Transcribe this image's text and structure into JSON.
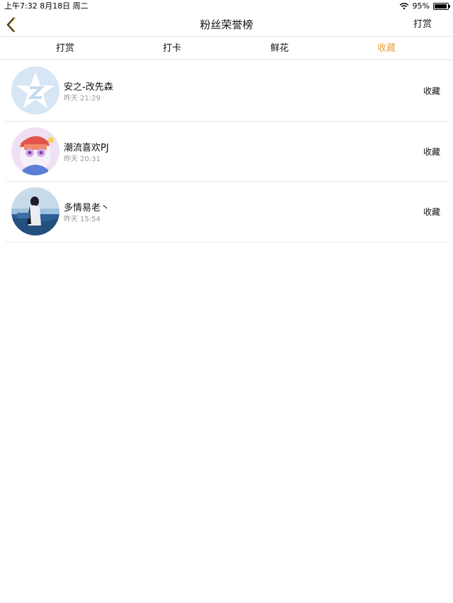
{
  "status_bar": {
    "time_date": "上午7:32   8月18日 周二",
    "battery": "95%",
    "battery_level": 0.95
  },
  "nav": {
    "back_icon": "chevron-left-icon",
    "title": "粉丝荣誉榜",
    "action": "打赏"
  },
  "tabs": [
    {
      "label": "打赏",
      "active": false
    },
    {
      "label": "打卡",
      "active": false
    },
    {
      "label": "鲜花",
      "active": false
    },
    {
      "label": "收藏",
      "active": true
    }
  ],
  "colors": {
    "accent": "#e8a33c",
    "divider": "#e6e6e6",
    "secondary_text": "#999999"
  },
  "list": [
    {
      "name": "安之-改先森",
      "time": "昨天 21:29",
      "action": "收藏",
      "avatar": "qq-logo-avatar"
    },
    {
      "name": "潮流喜欢PJ",
      "time": "昨天 20:31",
      "action": "收藏",
      "avatar": "cartoon-avatar"
    },
    {
      "name": "多情易老丶",
      "time": "昨天 15:54",
      "action": "收藏",
      "avatar": "photo-avatar"
    }
  ]
}
